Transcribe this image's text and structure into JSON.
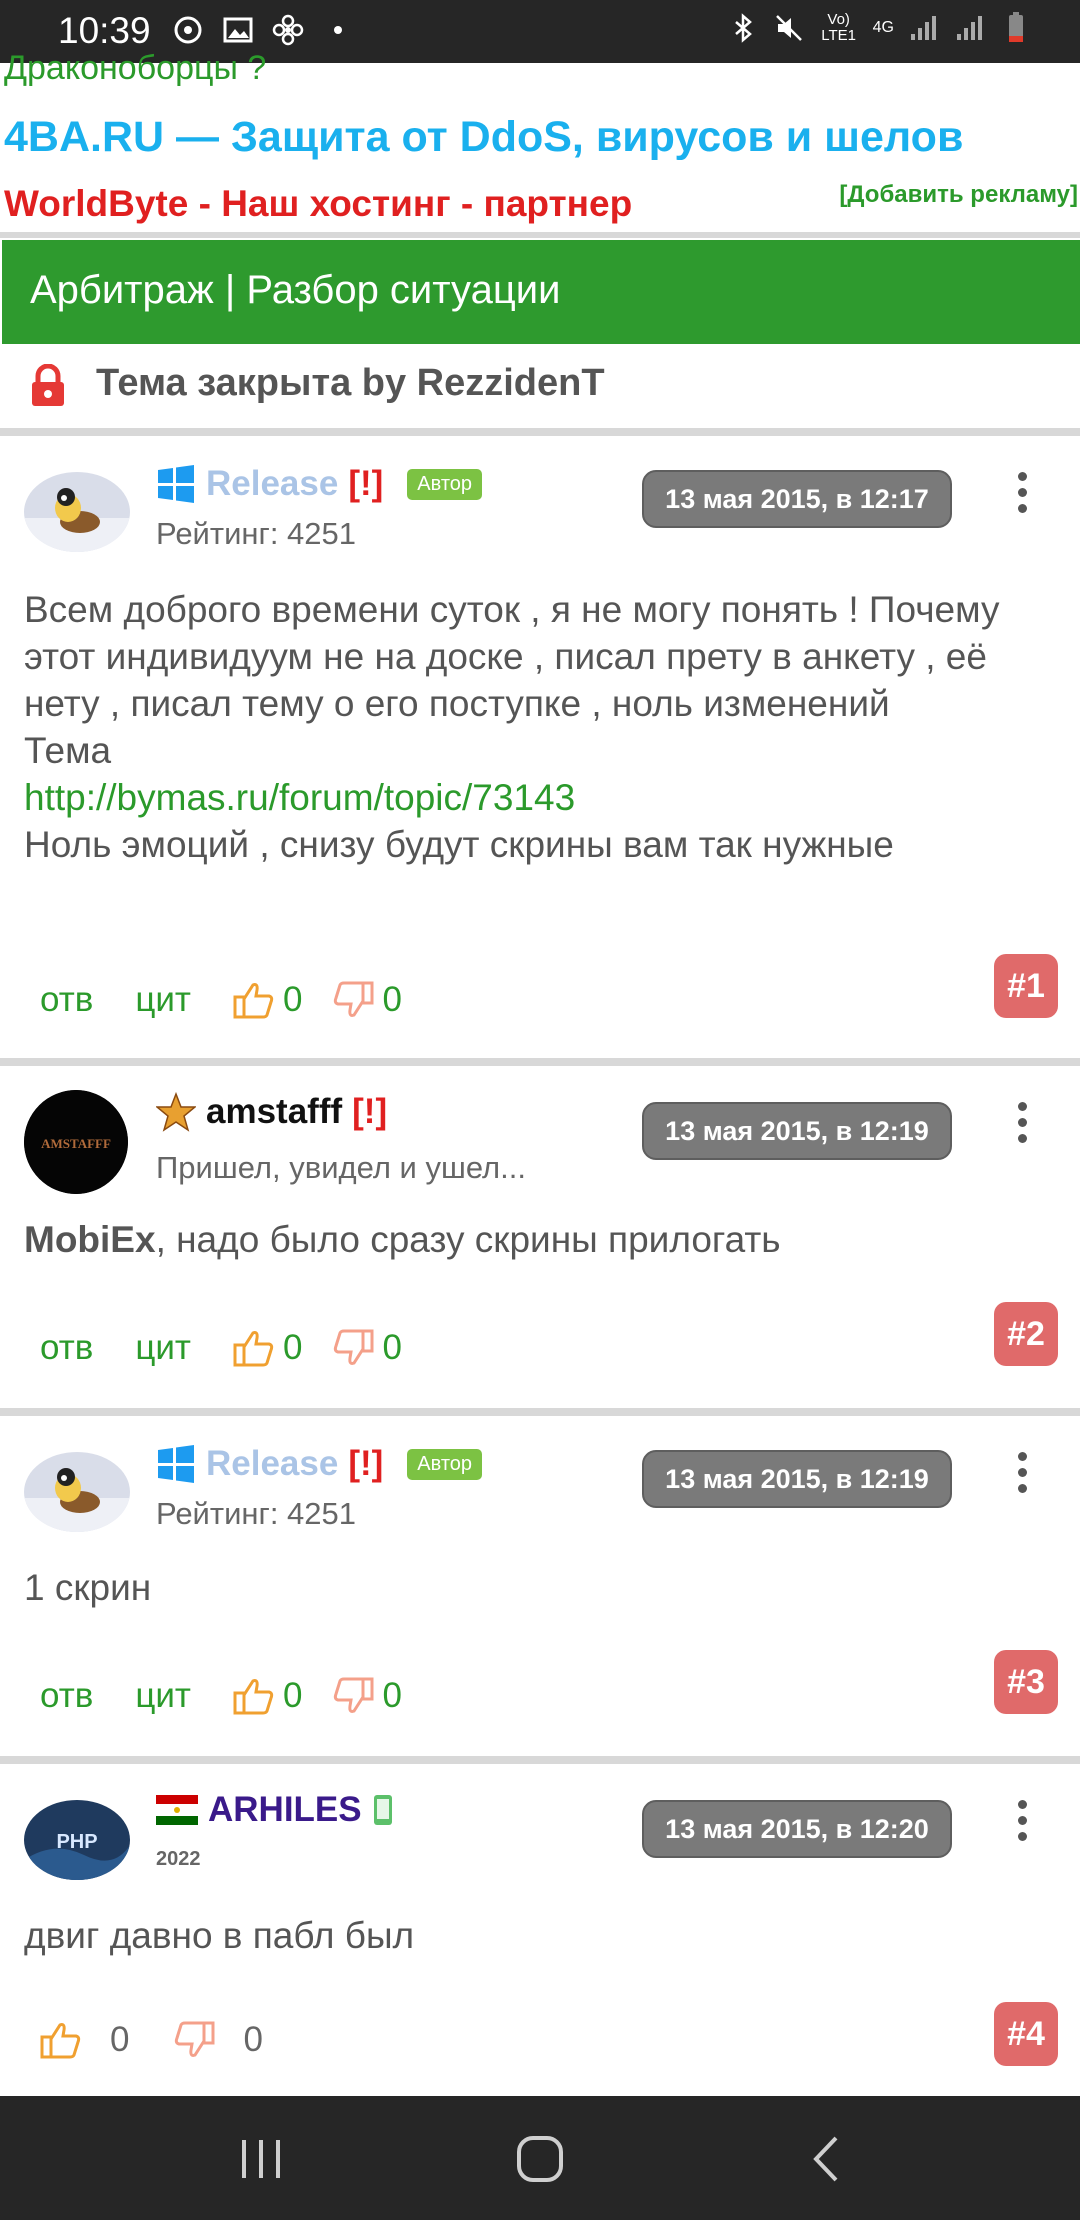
{
  "status_bar": {
    "time": "10:39",
    "network": "Vo) LTE1",
    "network_type": "4G"
  },
  "ads": {
    "cut_text": "Драконоборцы ?",
    "line1": "4BA.RU — Защита от DdoS, вирусов и шелов",
    "line2": "WorldByte - Наш хостинг - партнер",
    "add_ad": "[Добавить рекламу]"
  },
  "breadcrumb": "Арбитраж | Разбор ситуации",
  "topic_closed": "Тема закрыта by RezzidenT",
  "posts": [
    {
      "username": "Release",
      "mark": "[!]",
      "badge": "Автор",
      "subtitle": "Рейтинг: 4251",
      "date": "13 мая 2015, в 12:17",
      "text1": "Всем доброго времени суток , я не могу понять ! Почему этот индивидуум не на доске , писал прету в анкету , её нету , писал тему о его поступке , ноль изменений",
      "text2": "Тема",
      "link": "http://bymas.ru/forum/topic/73143",
      "text3": "Ноль эмоций , снизу будут скрины вам так нужные",
      "reply": "отв",
      "quote": "цит",
      "likes": "0",
      "dislikes": "0",
      "number": "#1"
    },
    {
      "username": "amstafff",
      "mark": "[!]",
      "avatar_text": "AMSTAFFF",
      "subtitle": "Пришел, увидел и ушел...",
      "date": "13 мая 2015, в 12:19",
      "mention": "MobiEx",
      "text": ", надо было сразу скрины прилогать",
      "reply": "отв",
      "quote": "цит",
      "likes": "0",
      "dislikes": "0",
      "number": "#2"
    },
    {
      "username": "Release",
      "mark": "[!]",
      "badge": "Автор",
      "subtitle": "Рейтинг: 4251",
      "date": "13 мая 2015, в 12:19",
      "text": "1 скрин",
      "reply": "отв",
      "quote": "цит",
      "likes": "0",
      "dislikes": "0",
      "number": "#3"
    },
    {
      "username": "ARHILES",
      "avatar_text": "PHP",
      "subtitle": "2022",
      "date": "13 мая 2015, в 12:20",
      "text": "двиг давно в пабл был",
      "likes": "0",
      "dislikes": "0",
      "number": "#4"
    }
  ],
  "colors": {
    "green": "#2e9a2e",
    "blue_ad": "#1ab0ee",
    "red": "#e02020",
    "post_number": "#e06a6a",
    "date_badge": "#7a7a7a"
  }
}
